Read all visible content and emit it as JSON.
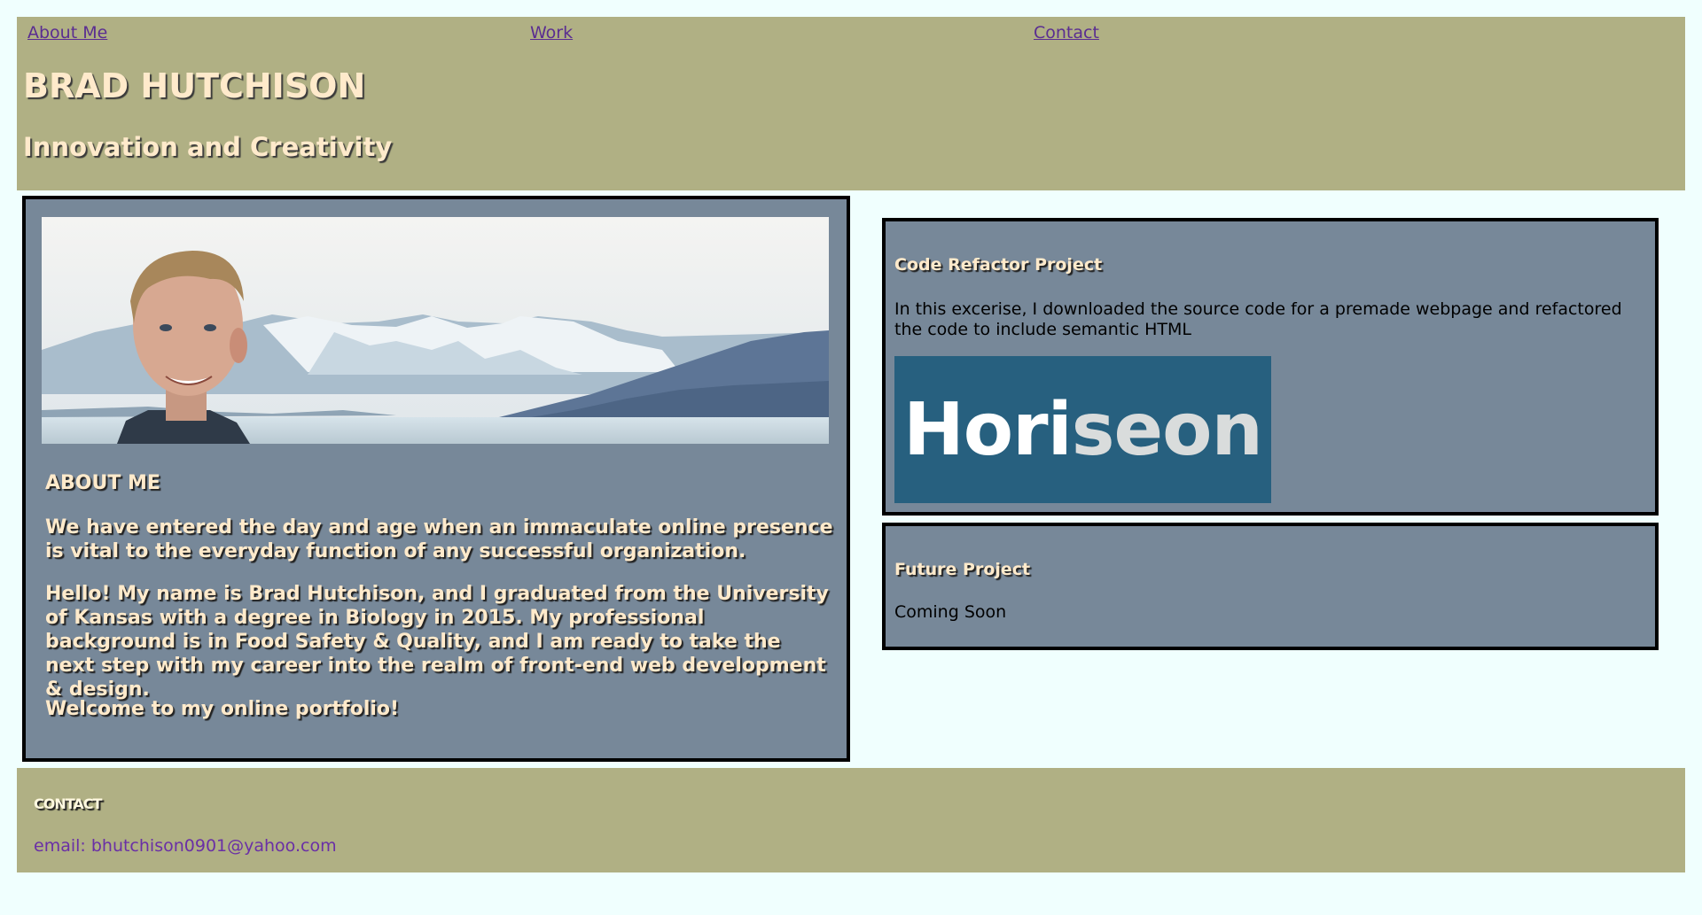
{
  "nav": {
    "items": [
      {
        "label": "About Me"
      },
      {
        "label": "Work"
      },
      {
        "label": "Contact"
      }
    ]
  },
  "header": {
    "title": "BRAD HUTCHISON",
    "tagline": "Innovation and Creativity"
  },
  "about": {
    "heading": "ABOUT ME",
    "paragraphs": [
      "We have entered the day and age when an immaculate online presence is vital to the everyday function of any successful organization.",
      "Hello! My name is Brad Hutchison, and I graduated from the University of Kansas with a degree in Biology in 2015. My professional background is in Food Safety & Quality, and I am ready to take the next step with my career into the realm of front-end web development & design.",
      "Welcome to my online portfolio!"
    ]
  },
  "projects": [
    {
      "title": "Code Refactor Project",
      "description": "In this excerise, I downloaded the source code for a premade webpage and refactored the code to include semantic HTML",
      "logo": {
        "part1": "Hori",
        "part2": "seon"
      }
    },
    {
      "title": "Future Project",
      "description": "Coming Soon"
    }
  ],
  "footer": {
    "heading": "CONTACT",
    "email": "email: bhutchison0901@yahoo.com"
  },
  "colors": {
    "background": "#f0fffe",
    "header_bg": "#b0b084",
    "panel_bg": "#778899",
    "heading_text": "#ffeacb",
    "link": "#5a2d91",
    "logo_bg": "#27607f"
  }
}
